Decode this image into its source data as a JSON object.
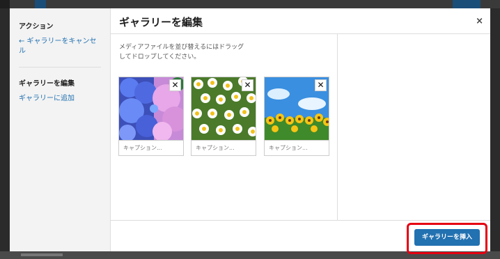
{
  "sidebar": {
    "actions_heading": "アクション",
    "cancel_link": "← ギャラリーをキャンセル",
    "edit_heading": "ギャラリーを編集",
    "add_link": "ギャラリーに追加"
  },
  "modal": {
    "title": "ギャラリーを編集",
    "close_glyph": "×",
    "hint_line1": "メディアファイルを並び替えるにはドラッグ",
    "hint_line2": "してドロップしてください。"
  },
  "gallery": {
    "items": [
      {
        "caption_placeholder": "キャプション...",
        "remove_glyph": "✕"
      },
      {
        "caption_placeholder": "キャプション...",
        "remove_glyph": "✕"
      },
      {
        "caption_placeholder": "キャプション...",
        "remove_glyph": "✕"
      }
    ]
  },
  "footer": {
    "insert_label": "ギャラリーを挿入",
    "highlight_color": "#e60012",
    "button_color": "#2271b1"
  }
}
